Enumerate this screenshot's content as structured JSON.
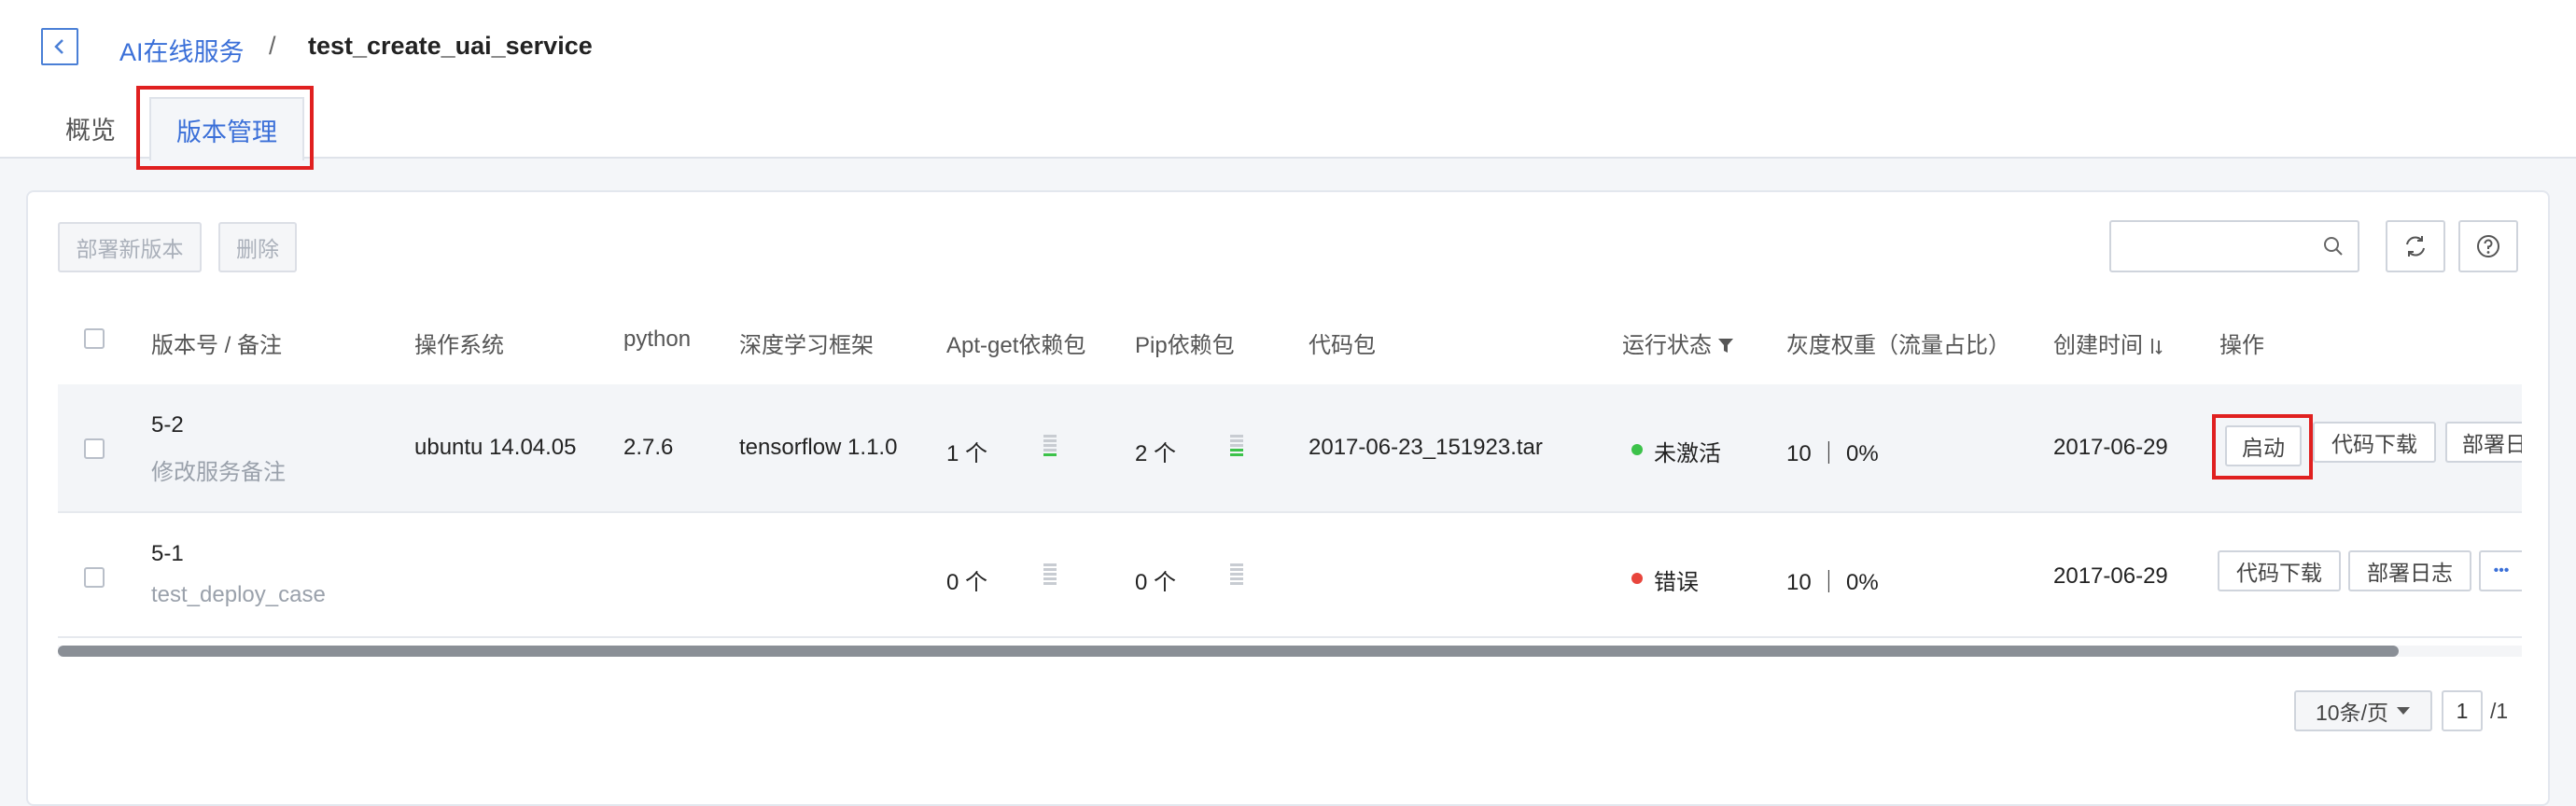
{
  "breadcrumb": {
    "parent": "AI在线服务",
    "separator": "/",
    "current": "test_create_uai_service"
  },
  "tabs": [
    {
      "label": "概览",
      "active": false
    },
    {
      "label": "版本管理",
      "active": true
    }
  ],
  "toolbar": {
    "deploy_label": "部署新版本",
    "delete_label": "删除",
    "search_placeholder": "",
    "refresh_icon": "refresh-icon",
    "help_icon": "help-icon"
  },
  "table": {
    "headers": {
      "version": "版本号 / 备注",
      "os": "操作系统",
      "python": "python",
      "framework": "深度学习框架",
      "apt": "Apt-get依赖包",
      "pip": "Pip依赖包",
      "code": "代码包",
      "status": "运行状态",
      "gray": "灰度权重（流量占比）",
      "created": "创建时间",
      "ops": "操作"
    },
    "rows": [
      {
        "version": "5-2",
        "note": "修改服务备注",
        "os": "ubuntu 14.04.05",
        "python": "2.7.6",
        "framework": "tensorflow 1.1.0",
        "apt": "1 个",
        "pip": "2 个",
        "code": "2017-06-23_151923.tar",
        "status": "未激活",
        "status_color": "#3cc24a",
        "gray": "10 ｜ 0%",
        "created": "2017-06-29",
        "actions": [
          "启动",
          "代码下载",
          "部署日"
        ]
      },
      {
        "version": "5-1",
        "note": "test_deploy_case",
        "os": "",
        "python": "",
        "framework": "",
        "apt": "0 个",
        "pip": "0 个",
        "code": "",
        "status": "错误",
        "status_color": "#e8453c",
        "gray": "10 ｜ 0%",
        "created": "2017-06-29",
        "actions": [
          "代码下载",
          "部署日志",
          "•••"
        ]
      }
    ]
  },
  "pagination": {
    "page_size": "10条/页",
    "current_page": "1",
    "total_pages": "/1"
  },
  "colors": {
    "accent": "#3a6fd8",
    "highlight_box": "#e02020",
    "bars_green": "#3cc24a",
    "bars_gray": "#c8ccd2"
  }
}
